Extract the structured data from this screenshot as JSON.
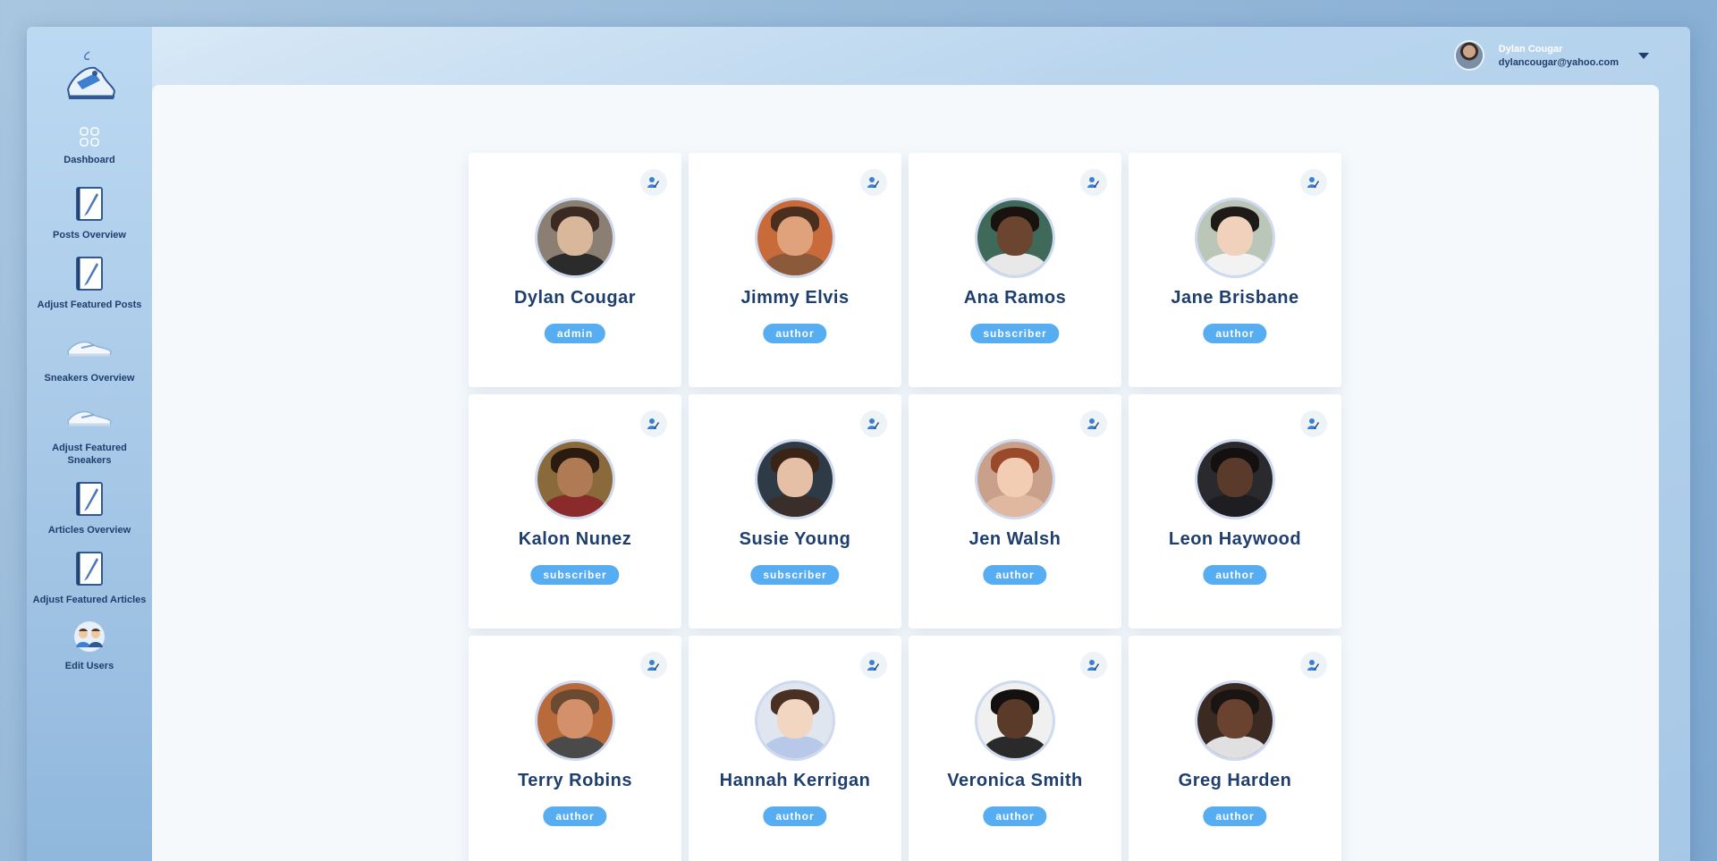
{
  "sidebar": {
    "items": [
      {
        "label": "Dashboard",
        "icon": "grid-icon"
      },
      {
        "label": "Posts Overview",
        "icon": "notepad-icon"
      },
      {
        "label": "Adjust Featured Posts",
        "icon": "notepad-icon"
      },
      {
        "label": "Sneakers Overview",
        "icon": "sneaker-icon"
      },
      {
        "label": "Adjust Featured Sneakers",
        "icon": "sneaker-icon"
      },
      {
        "label": "Articles Overview",
        "icon": "notepad-icon"
      },
      {
        "label": "Adjust Featured Articles",
        "icon": "notepad-icon"
      },
      {
        "label": "Edit Users",
        "icon": "users-icon"
      }
    ]
  },
  "header": {
    "user_name": "Dylan Cougar",
    "user_email": "dylancougar@yahoo.com"
  },
  "users": [
    {
      "name": "Dylan Cougar",
      "role": "admin"
    },
    {
      "name": "Jimmy Elvis",
      "role": "author"
    },
    {
      "name": "Ana Ramos",
      "role": "subscriber"
    },
    {
      "name": "Jane Brisbane",
      "role": "author"
    },
    {
      "name": "Kalon Nunez",
      "role": "subscriber"
    },
    {
      "name": "Susie Young",
      "role": "subscriber"
    },
    {
      "name": "Jen Walsh",
      "role": "author"
    },
    {
      "name": "Leon Haywood",
      "role": "author"
    },
    {
      "name": "Terry Robins",
      "role": "author"
    },
    {
      "name": "Hannah Kerrigan",
      "role": "author"
    },
    {
      "name": "Veronica Smith",
      "role": "author"
    },
    {
      "name": "Greg Harden",
      "role": "author"
    }
  ],
  "colors": {
    "accent": "#56adf2",
    "text_dark": "#1e3f6e"
  }
}
